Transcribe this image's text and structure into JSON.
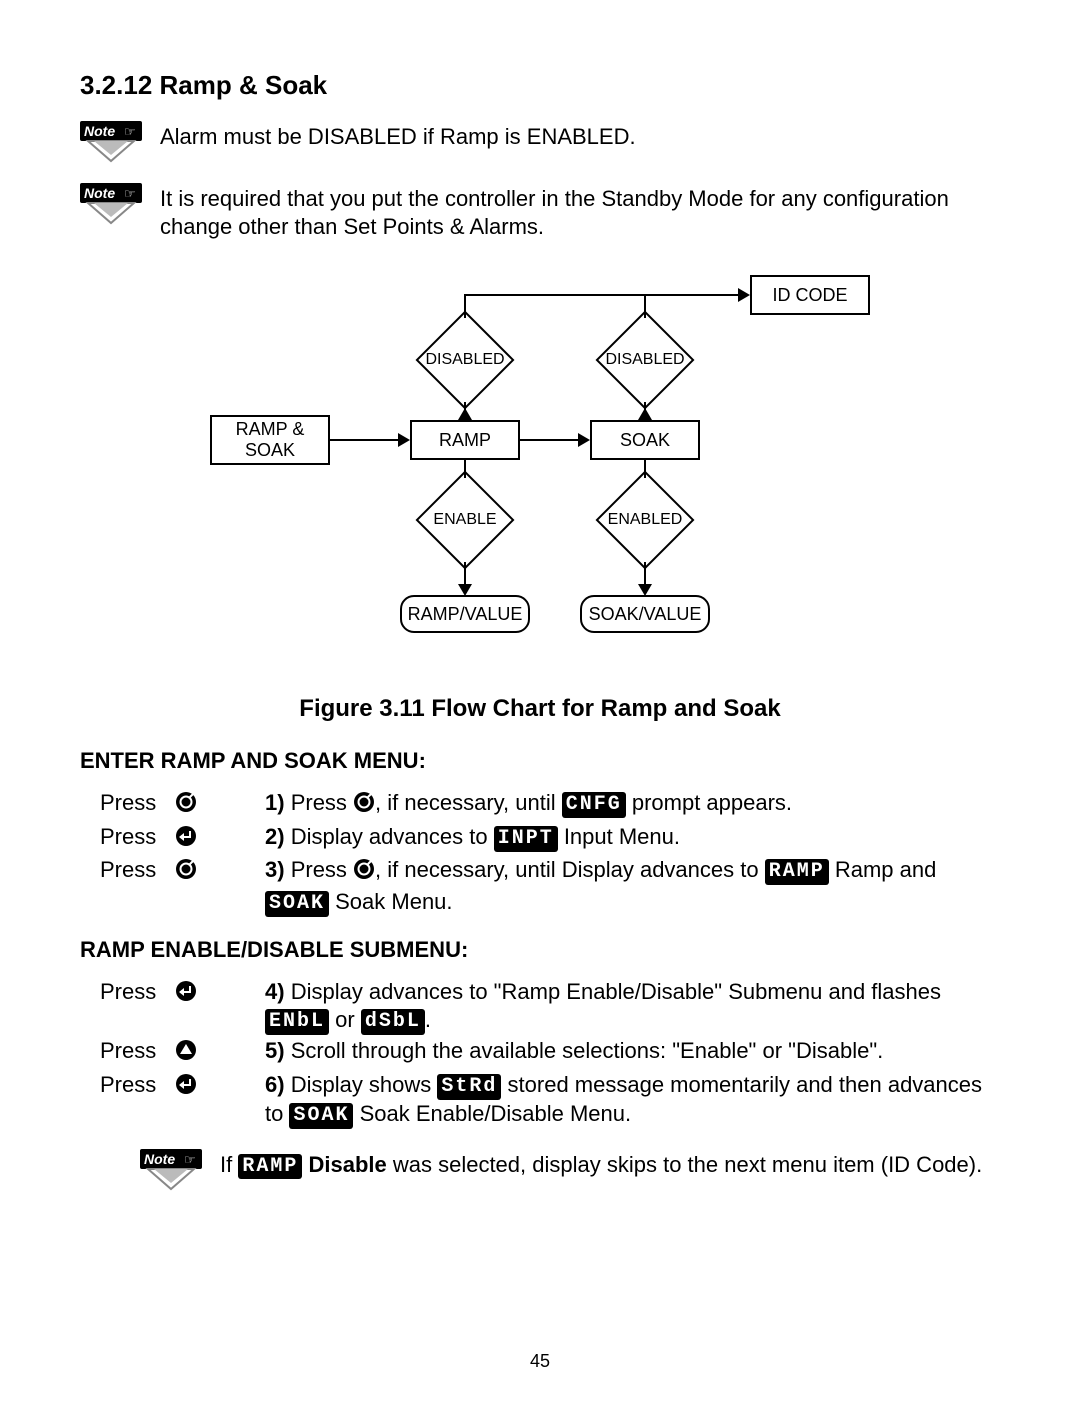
{
  "section_title": "3.2.12 Ramp & Soak",
  "notes": {
    "n1": "Alarm must be DISABLED if Ramp is ENABLED.",
    "n2": "It is required that you put the controller in the Standby Mode for any configuration change other than Set Points & Alarms."
  },
  "flowchart": {
    "ramp_soak": "RAMP &\nSOAK",
    "ramp": "RAMP",
    "soak": "SOAK",
    "disabled": "DISABLED",
    "enable": "ENABLE",
    "enabled": "ENABLED",
    "ramp_value": "RAMP/VALUE",
    "soak_value": "SOAK/VALUE",
    "id_code": "ID CODE"
  },
  "figure_caption": "Figure 3.11 Flow Chart for Ramp and Soak",
  "menu1": {
    "heading": "ENTER RAMP AND SOAK MENU:",
    "press": "Press",
    "steps": {
      "s1_num": "1)",
      "s1_a": "Press ",
      "s1_b": ", if necessary, until ",
      "s1_seg": "CNFG",
      "s1_c": " prompt appears.",
      "s2_num": "2)",
      "s2_a": "Display advances to ",
      "s2_seg": "INPT",
      "s2_b": " Input Menu.",
      "s3_num": "3)",
      "s3_a": "Press ",
      "s3_b": ", if necessary, until Display advances to ",
      "s3_seg1": "RAMP",
      "s3_c": " Ramp and ",
      "s3_seg2": "SOAK",
      "s3_d": " Soak Menu."
    }
  },
  "menu2": {
    "heading": "RAMP ENABLE/DISABLE SUBMENU:",
    "press": "Press",
    "steps": {
      "s4_num": "4)",
      "s4_a": "Display advances to \"Ramp Enable/Disable\" Submenu and flashes ",
      "s4_seg1": "ENbL",
      "s4_b": " or ",
      "s4_seg2": "dSbL",
      "s4_c": ".",
      "s5_num": "5)",
      "s5_a": "Scroll through the available selections: \"Enable\" or \"Disable\".",
      "s6_num": "6)",
      "s6_a": "Display shows ",
      "s6_seg1": "StRd",
      "s6_b": " stored message momentarily and then advances to ",
      "s6_seg2": "SOAK",
      "s6_c": " Soak Enable/Disable Menu."
    },
    "note_a": "If ",
    "note_seg": "RAMP",
    "note_b": " Disable",
    "note_c": " was selected, display skips to the next menu item (ID Code)."
  },
  "page_number": "45"
}
